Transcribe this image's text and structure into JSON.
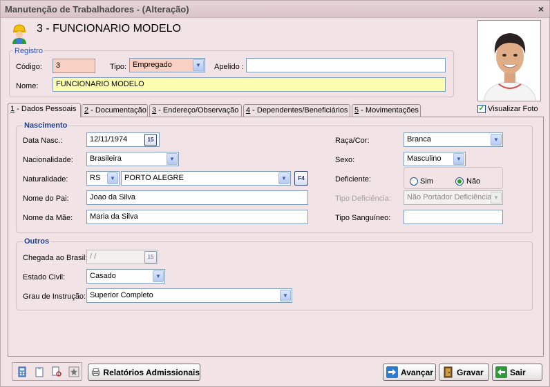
{
  "window": {
    "title": "Manutenção de Trabalhadores - (Alteração)",
    "close_label": "×"
  },
  "header": {
    "employee_heading": "3 - FUNCIONARIO MODELO"
  },
  "registro": {
    "group_title": "Registro",
    "codigo_label": "Código:",
    "codigo_value": "3",
    "tipo_label": "Tipo:",
    "tipo_value": "Empregado",
    "apelido_label": "Apelido :",
    "apelido_value": "",
    "nome_label": "Nome:",
    "nome_value": "FUNCIONARIO MODELO"
  },
  "photo": {
    "show_photo_label": "Visualizar Foto",
    "show_photo_checked": true
  },
  "tabs": [
    {
      "key": "1",
      "label": " - Dados Pessoais"
    },
    {
      "key": "2",
      "label": " - Documentação"
    },
    {
      "key": "3",
      "label": " - Endereço/Observação"
    },
    {
      "key": "4",
      "label": " - Dependentes/Beneficiários"
    },
    {
      "key": "5",
      "label": " - Movimentações"
    }
  ],
  "nascimento": {
    "group_title": "Nascimento",
    "data_nasc_label": "Data Nasc.:",
    "data_nasc_value": "12/11/1974",
    "calendar_label": "15",
    "nacionalidade_label": "Nacionalidade:",
    "nacionalidade_value": "Brasileira",
    "naturalidade_label": "Naturalidade:",
    "naturalidade_uf": "RS",
    "naturalidade_city": "PORTO ALEGRE",
    "f4_label": "F4",
    "pai_label": "Nome do Pai:",
    "pai_value": "Joao da Silva",
    "mae_label": "Nome da Mãe:",
    "mae_value": "Maria da Silva",
    "raca_label": "Raça/Cor:",
    "raca_value": "Branca",
    "sexo_label": "Sexo:",
    "sexo_value": "Masculino",
    "deficiente_label": "Deficiente:",
    "sim_label": "Sim",
    "nao_label": "Não",
    "tipo_def_label": "Tipo Deficiência:",
    "tipo_def_value": "Não Portador Deficiência",
    "sangue_label": "Tipo Sanguíneo:",
    "sangue_value": ""
  },
  "outros": {
    "group_title": "Outros",
    "chegada_label": "Chegada ao Brasil:",
    "chegada_value": " /  /",
    "estado_civil_label": "Estado Civil:",
    "estado_civil_value": "Casado",
    "instrucao_label": "Grau de Instrução:",
    "instrucao_value": "Superior Completo"
  },
  "footer": {
    "relatorios_label": "Relatórios Admissionais",
    "avancar_label": "Avançar",
    "gravar_label": "Gravar",
    "sair_label": "Sair"
  },
  "colors": {
    "accent_blue": "#1f3f8f",
    "pink_field": "#f8d0c4",
    "yellow_field": "#fdfdb0"
  }
}
